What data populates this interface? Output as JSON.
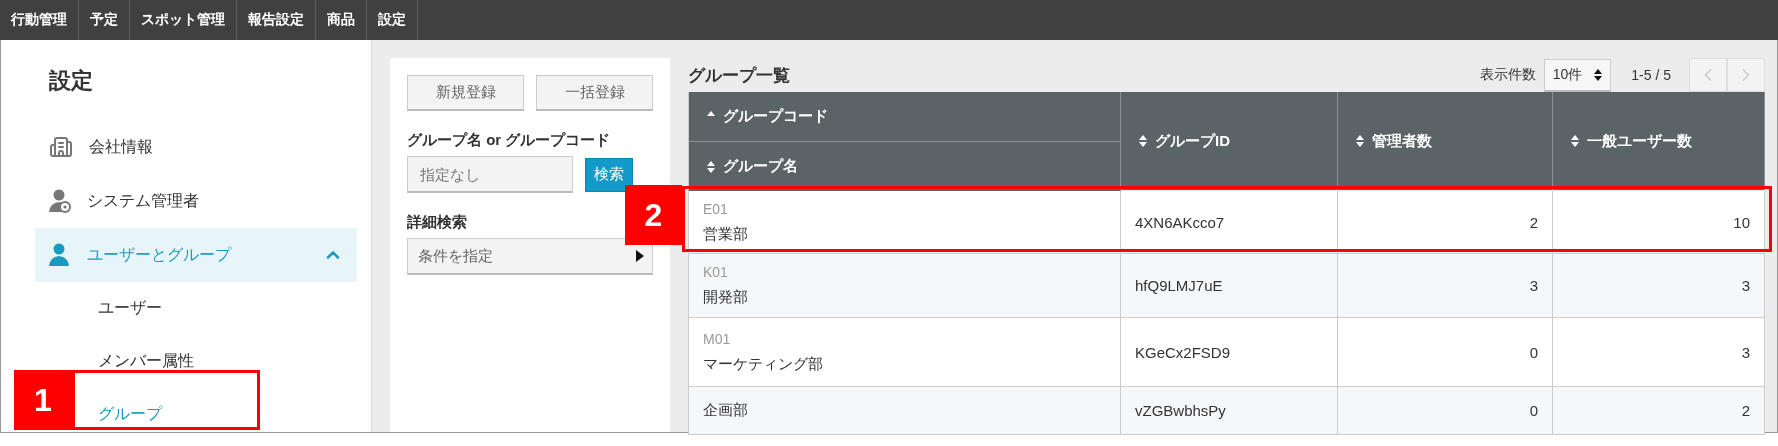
{
  "top_nav": [
    {
      "label": "行動管理"
    },
    {
      "label": "予定"
    },
    {
      "label": "スポット管理"
    },
    {
      "label": "報告設定"
    },
    {
      "label": "商品"
    },
    {
      "label": "設定"
    }
  ],
  "sidebar": {
    "title": "設定",
    "items": [
      {
        "label": "会社情報",
        "kind": "building",
        "expanded": false
      },
      {
        "label": "システム管理者",
        "kind": "admin",
        "expanded": false
      },
      {
        "label": "ユーザーとグループ",
        "kind": "user",
        "expanded": true,
        "children": [
          {
            "label": "ユーザー",
            "selected": false
          },
          {
            "label": "メンバー属性",
            "selected": false
          },
          {
            "label": "グループ",
            "selected": true
          }
        ]
      }
    ]
  },
  "search_panel": {
    "buttons": [
      "新規登録",
      "一括登録"
    ],
    "search_label": "グループ名 or グループコード",
    "search_placeholder": "指定なし",
    "search_button": "検索",
    "detail_label": "詳細検索",
    "detail_select": "条件を指定"
  },
  "list": {
    "title": "グループ一覧",
    "page_size_label": "表示件数",
    "page_size": "10件",
    "range": "1-5 / 5",
    "prev_disabled": true,
    "next_disabled": true
  },
  "table": {
    "columns": [
      {
        "label": "グループコード",
        "sorted": true
      },
      {
        "label": "グループ名",
        "sorted": false
      },
      {
        "label": "グループID",
        "sorted": false
      },
      {
        "label": "管理者数",
        "sorted": false
      },
      {
        "label": "一般ユーザー数",
        "sorted": false
      }
    ],
    "rows": [
      {
        "code": "E01",
        "name": "営業部",
        "id": "4XN6AKcco7",
        "admins": "2",
        "users": "10"
      },
      {
        "code": "K01",
        "name": "開発部",
        "id": "hfQ9LMJ7uE",
        "admins": "3",
        "users": "3"
      },
      {
        "code": "M01",
        "name": "マーケティング部",
        "id": "KGeCx2FSD9",
        "admins": "0",
        "users": "3"
      },
      {
        "name": "企画部",
        "id": "vZGBwbhsPy",
        "admins": "0",
        "users": "2"
      }
    ]
  },
  "annotations": [
    {
      "label": "1"
    },
    {
      "label": "2"
    }
  ]
}
